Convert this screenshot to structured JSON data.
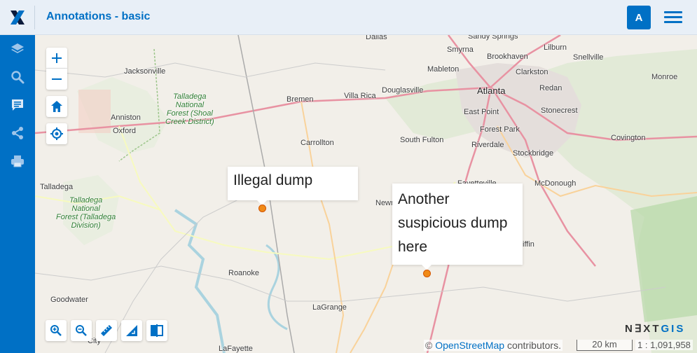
{
  "header": {
    "title": "Annotations - basic",
    "avatar_letter": "A",
    "accent_color": "#0070c5"
  },
  "sidebar": {
    "items": [
      {
        "icon": "layers-icon"
      },
      {
        "icon": "search-icon"
      },
      {
        "icon": "annotations-icon"
      },
      {
        "icon": "share-icon"
      },
      {
        "icon": "print-icon"
      }
    ]
  },
  "map": {
    "controls": [
      "zoom-in",
      "zoom-out",
      "home",
      "locate"
    ],
    "tools": [
      "zoom-in-tool",
      "zoom-out-tool",
      "measure-distance",
      "measure-area",
      "swipe"
    ],
    "places": {
      "dallas": "Dallas",
      "sandy_springs": "Sandy Springs",
      "smyrna": "Smyrna",
      "brookhaven": "Brookhaven",
      "lilburn": "Lilburn",
      "snellville": "Snellville",
      "jacksonville": "Jacksonville",
      "mableton": "Mableton",
      "clarkston": "Clarkston",
      "monroe": "Monroe",
      "atlanta": "Atlanta",
      "redan": "Redan",
      "bremen": "Bremen",
      "villa_rica": "Villa Rica",
      "douglasville": "Douglasville",
      "anniston": "Anniston",
      "east_point": "East Point",
      "stonecrest": "Stonecrest",
      "oxford": "Oxford",
      "forest_park": "Forest Park",
      "covington": "Covington",
      "south_fulton": "South Fulton",
      "carrollton": "Carrollton",
      "riverdale": "Riverdale",
      "stockbridge": "Stockbridge",
      "fayetteville": "Fayetteville",
      "mcdonough": "McDonough",
      "talladega": "Talladega",
      "newnan": "Newn",
      "griffin": "iffin",
      "roanoke": "Roanoke",
      "goodwater": "Goodwater",
      "lagrange": "LaGrange",
      "lafayette": "LaFayette",
      "city": "City"
    },
    "forests": {
      "shoal_creek": [
        "Talladega",
        "National",
        "Forest (Shoal",
        "Creek District)"
      ],
      "talladega_div": [
        "Talladega",
        "National",
        "Forest (Talladega",
        "Division)"
      ]
    },
    "annotations": [
      {
        "text": "Illegal dump"
      },
      {
        "text": "Another suspicious dump here"
      }
    ],
    "marker_color": "#f08a17",
    "brand": {
      "part1": "N∃XT",
      "part2": "GIS"
    },
    "attribution": {
      "symbol": "©",
      "link": "OpenStreetMap",
      "suffix": " contributors."
    },
    "scale": {
      "bar_label": "20 km",
      "ratio": "1 : 1,091,958"
    }
  }
}
